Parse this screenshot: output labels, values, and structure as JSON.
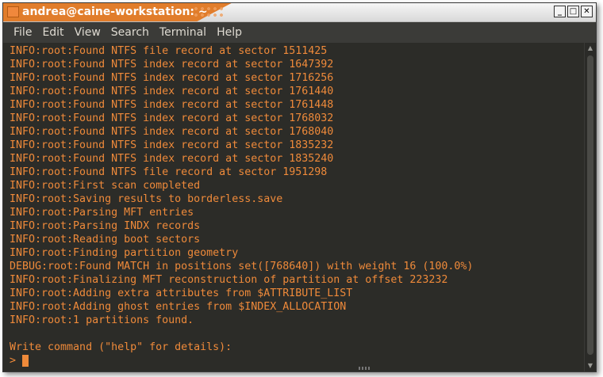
{
  "window": {
    "title": "andrea@caine-workstation: ~",
    "controls": {
      "minimize": "_",
      "maximize": "□",
      "close": "✕"
    }
  },
  "menu": [
    "File",
    "Edit",
    "View",
    "Search",
    "Terminal",
    "Help"
  ],
  "terminal": {
    "lines": [
      "INFO:root:Found NTFS file record at sector 1511425",
      "INFO:root:Found NTFS index record at sector 1647392",
      "INFO:root:Found NTFS index record at sector 1716256",
      "INFO:root:Found NTFS index record at sector 1761440",
      "INFO:root:Found NTFS index record at sector 1761448",
      "INFO:root:Found NTFS index record at sector 1768032",
      "INFO:root:Found NTFS index record at sector 1768040",
      "INFO:root:Found NTFS index record at sector 1835232",
      "INFO:root:Found NTFS index record at sector 1835240",
      "INFO:root:Found NTFS file record at sector 1951298",
      "INFO:root:First scan completed",
      "INFO:root:Saving results to borderless.save",
      "INFO:root:Parsing MFT entries",
      "INFO:root:Parsing INDX records",
      "INFO:root:Reading boot sectors",
      "INFO:root:Finding partition geometry",
      "DEBUG:root:Found MATCH in positions set([768640]) with weight 16 (100.0%)",
      "INFO:root:Finalizing MFT reconstruction of partition at offset 223232",
      "INFO:root:Adding extra attributes from $ATTRIBUTE_LIST",
      "INFO:root:Adding ghost entries from $INDEX_ALLOCATION",
      "INFO:root:1 partitions found.",
      "",
      "Write command (\"help\" for details):"
    ],
    "prompt": ">"
  },
  "colors": {
    "terminal_text": "#ef8a3a",
    "terminal_bg": "#2c2c28",
    "title_accent": "#e17d2b"
  },
  "icons": [
    "terminal-app-icon",
    "minimize-icon",
    "maximize-icon",
    "close-icon",
    "scroll-up-icon",
    "scroll-down-icon"
  ]
}
